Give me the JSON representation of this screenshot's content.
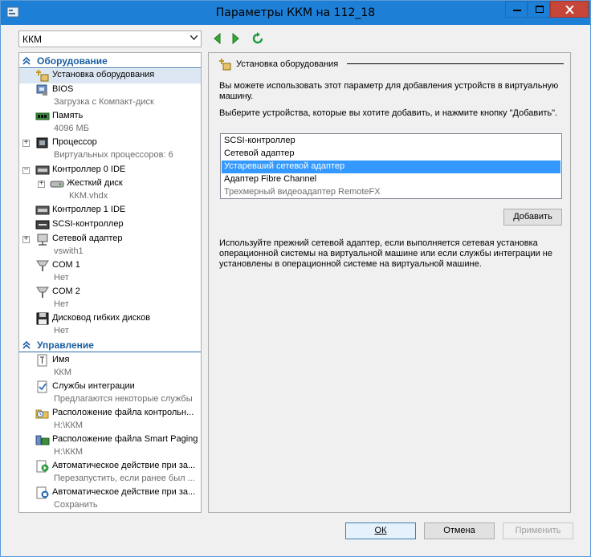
{
  "window": {
    "title": "Параметры ККМ на 112_18"
  },
  "toolbar": {
    "vm_select": "ККМ"
  },
  "sidebar": {
    "hardware_header": "Оборудование",
    "management_header": "Управление",
    "hardware_items": [
      {
        "label": "Установка оборудования",
        "sub": ""
      },
      {
        "label": "BIOS",
        "sub": "Загрузка с Компакт-диск"
      },
      {
        "label": "Память",
        "sub": "4096 МБ"
      },
      {
        "label": "Процессор",
        "sub": "Виртуальных процессоров: 6"
      },
      {
        "label": "Контроллер 0 IDE",
        "sub": ""
      },
      {
        "label": "Жесткий диск",
        "sub": "ККМ.vhdx"
      },
      {
        "label": "Контроллер 1 IDE",
        "sub": ""
      },
      {
        "label": "SCSI-контроллер",
        "sub": ""
      },
      {
        "label": "Сетевой адаптер",
        "sub": "vswith1"
      },
      {
        "label": "COM 1",
        "sub": "Нет"
      },
      {
        "label": "COM 2",
        "sub": "Нет"
      },
      {
        "label": "Дисковод гибких дисков",
        "sub": "Нет"
      }
    ],
    "management_items": [
      {
        "label": "Имя",
        "sub": "ККМ"
      },
      {
        "label": "Службы интеграции",
        "sub": "Предлагаются некоторые службы"
      },
      {
        "label": "Расположение файла контрольн...",
        "sub": "H:\\ККМ"
      },
      {
        "label": "Расположение файла Smart Paging",
        "sub": "H:\\ККМ"
      },
      {
        "label": "Автоматическое действие при за...",
        "sub": "Перезапустить, если ранее был ..."
      },
      {
        "label": "Автоматическое действие при за...",
        "sub": "Сохранить"
      }
    ]
  },
  "main": {
    "section_title": "Установка оборудования",
    "intro": "Вы можете использовать этот параметр для добавления устройств в виртуальную машину.",
    "instruction": "Выберите устройства, которые вы хотите добавить, и нажмите кнопку \"Добавить\".",
    "devices": [
      {
        "label": "SCSI-контроллер",
        "state": "normal"
      },
      {
        "label": "Сетевой адаптер",
        "state": "normal"
      },
      {
        "label": "Устаревший сетевой адаптер",
        "state": "selected"
      },
      {
        "label": "Адаптер Fibre Channel",
        "state": "normal"
      },
      {
        "label": "Трехмерный видеоадаптер RemoteFX",
        "state": "disabled"
      }
    ],
    "add_button": "Добавить",
    "description": "Используйте прежний сетевой адаптер, если выполняется сетевая установка операционной системы на виртуальной машине или если службы интеграции не установлены в операционной системе на виртуальной машине."
  },
  "footer": {
    "ok": "ОК",
    "cancel": "Отмена",
    "apply": "Применить"
  },
  "colors": {
    "titlebar": "#1e7fd6",
    "selection": "#3399ff",
    "section_header": "#1b5fa3"
  }
}
